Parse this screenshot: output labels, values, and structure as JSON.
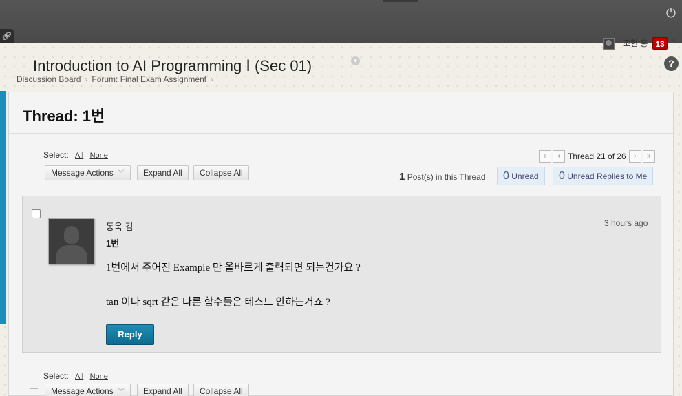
{
  "header": {
    "user_name": "조현 홍",
    "notification_count": "13",
    "course_title": "Introduction to AI Programming Ⅰ (Sec 01)",
    "help_label": "?"
  },
  "breadcrumb": [
    "Discussion Board",
    "Forum: Final Exam Assignment"
  ],
  "thread": {
    "title": "Thread: 1번",
    "select_label": "Select:",
    "select_all": "All",
    "select_none": "None",
    "message_actions": "Message Actions",
    "expand_all": "Expand All",
    "collapse_all": "Collapse All",
    "pager_text": "Thread 21 of 26",
    "posts_count": "1",
    "posts_label": "Post(s) in this Thread",
    "unread_count": "0",
    "unread_label": "Unread",
    "unread_replies_count": "0",
    "unread_replies_label": "Unread Replies to Me"
  },
  "post": {
    "author": "동욱 김",
    "subject": "1번",
    "time": "3 hours ago",
    "body_lines": [
      "1번에서 주어진 Example 만 올바르게 출력되면 되는건가요 ?",
      "tan 이나 sqrt 같은 다른 함수들은 테스트 안하는거죠 ?"
    ],
    "reply_label": "Reply"
  },
  "icons": {
    "link": "link-icon",
    "power": "power-icon",
    "help": "help-icon",
    "first": "double-chevron-left-icon",
    "prev": "chevron-left-icon",
    "next": "chevron-right-icon",
    "last": "double-chevron-right-icon"
  },
  "colors": {
    "accent": "#1b8fb7",
    "badge": "#c00000",
    "topbar": "#4a4a4a",
    "reply_button": "#0e6a90"
  }
}
